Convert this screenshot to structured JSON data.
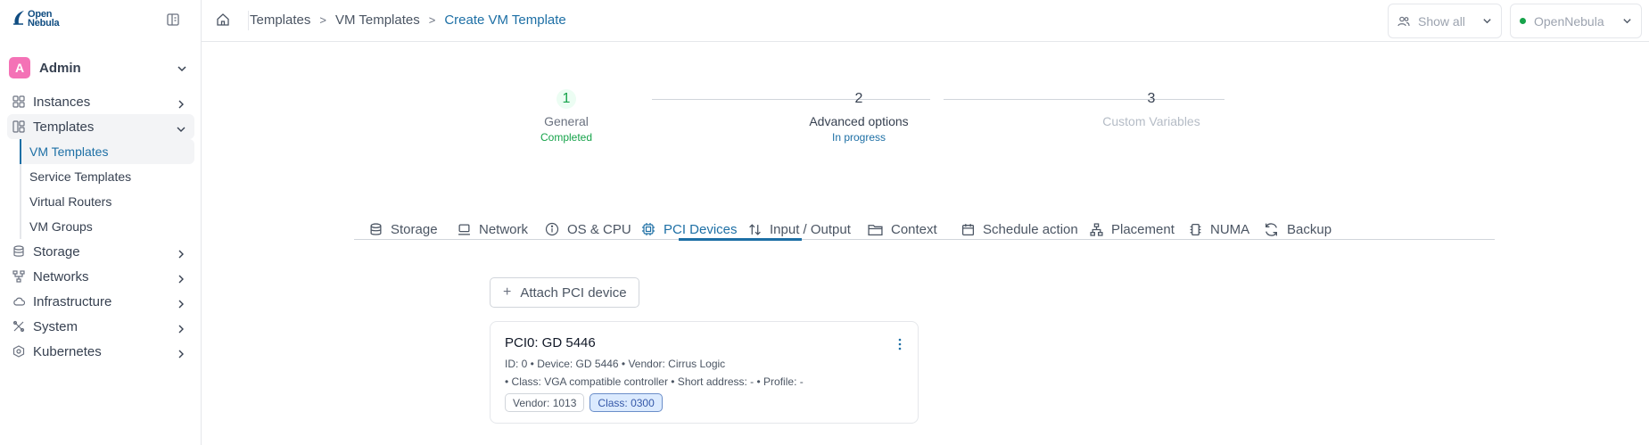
{
  "logo": {
    "line1": "Open",
    "line2": "Nebula"
  },
  "user": {
    "initial": "A",
    "name": "Admin"
  },
  "nav": {
    "instances": "Instances",
    "templates": "Templates",
    "templates_sub": [
      "VM Templates",
      "Service Templates",
      "Virtual Routers",
      "VM Groups"
    ],
    "storage": "Storage",
    "networks": "Networks",
    "infrastructure": "Infrastructure",
    "system": "System",
    "kubernetes": "Kubernetes"
  },
  "breadcrumb": {
    "items": [
      "Templates",
      "VM Templates",
      "Create VM Template"
    ],
    "separator": ">"
  },
  "topbar": {
    "show_all": "Show all",
    "zone": "OpenNebula"
  },
  "stepper": {
    "steps": [
      {
        "num": "1",
        "title": "General",
        "status": "Completed"
      },
      {
        "num": "2",
        "title": "Advanced options",
        "status": "In progress"
      },
      {
        "num": "3",
        "title": "Custom Variables",
        "status": ""
      }
    ]
  },
  "tabs": [
    "Storage",
    "Network",
    "OS & CPU",
    "PCI Devices",
    "Input / Output",
    "Context",
    "Schedule action",
    "Placement",
    "NUMA",
    "Backup"
  ],
  "active_tab": "PCI Devices",
  "attach_button": "Attach PCI device",
  "pci": {
    "title": "PCI0: GD 5446",
    "line1": "ID: 0  •  Device: GD 5446  •  Vendor: Cirrus Logic",
    "line2": "•  Class: VGA compatible controller  •  Short address: -  •  Profile: -",
    "tags": [
      "Vendor: 1013",
      "Class: 0300"
    ]
  },
  "colors": {
    "accent": "#1d6fa5",
    "success": "#16a34a",
    "avatar": "#f472b6"
  }
}
